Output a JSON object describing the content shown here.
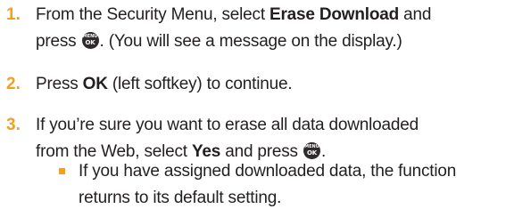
{
  "steps": [
    {
      "number": "1.",
      "line1_pre": "From the Security Menu, select ",
      "line1_bold": "Erase Download",
      "line1_post": " and",
      "line2_pre": "press ",
      "line2_post": ". (You will see a message on the display.)"
    },
    {
      "number": "2.",
      "pre": "Press ",
      "bold": "OK",
      "post": " (left softkey) to continue."
    },
    {
      "number": "3.",
      "line1": "If you’re sure you want to erase all data downloaded",
      "line2_pre": "from the Web, select ",
      "line2_bold": "Yes",
      "line2_mid": " and press ",
      "line2_post": "."
    }
  ],
  "bullet": {
    "line1": "If you have assigned downloaded data, the function",
    "line2": "returns to its default setting."
  },
  "menu_key": {
    "icon": "menu-ok-key-icon",
    "top_label": "MENU",
    "bottom_label": "OK"
  },
  "colors": {
    "accent": "#f0a21e",
    "text": "#231f20",
    "key": "#2f2b2c"
  }
}
